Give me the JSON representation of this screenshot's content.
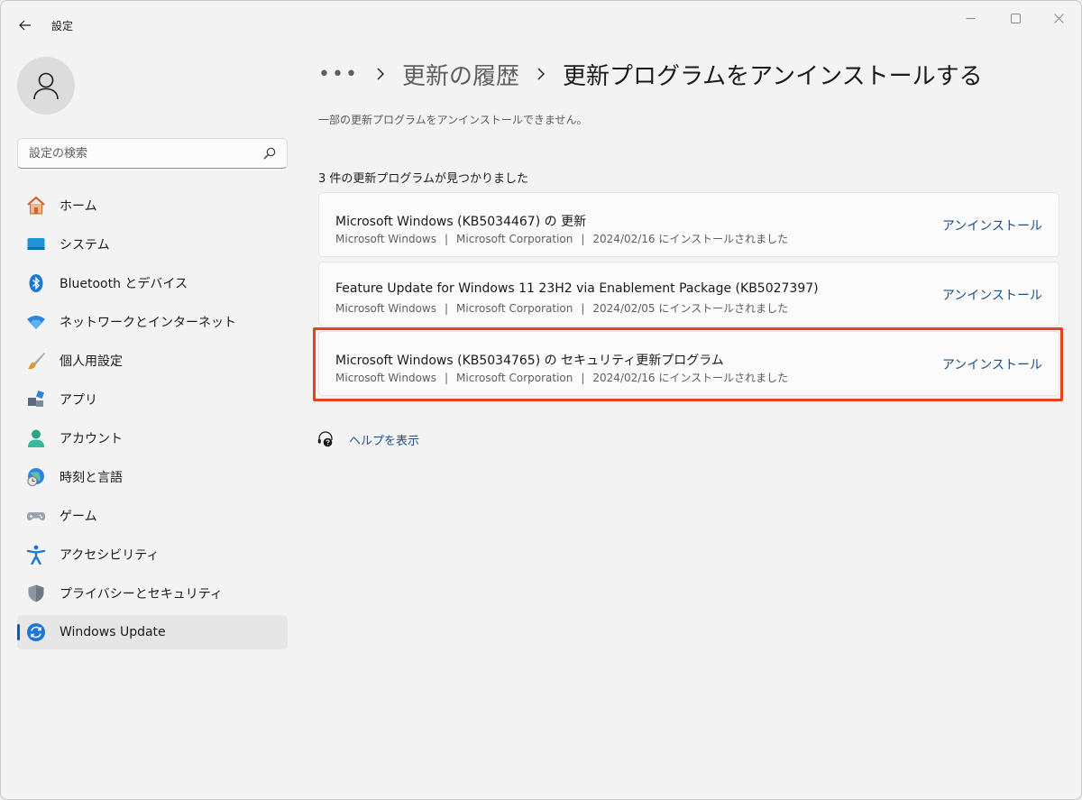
{
  "window": {
    "title": "設定",
    "controls": [
      "minimize-icon",
      "maximize-icon",
      "close-icon"
    ]
  },
  "sidebar": {
    "search_placeholder": "設定の検索",
    "items": [
      {
        "label": "ホーム",
        "icon": "home-icon"
      },
      {
        "label": "システム",
        "icon": "display-icon"
      },
      {
        "label": "Bluetooth とデバイス",
        "icon": "bluetooth-icon"
      },
      {
        "label": "ネットワークとインターネット",
        "icon": "wifi-icon"
      },
      {
        "label": "個人用設定",
        "icon": "brush-icon"
      },
      {
        "label": "アプリ",
        "icon": "apps-icon"
      },
      {
        "label": "アカウント",
        "icon": "account-icon"
      },
      {
        "label": "時刻と言語",
        "icon": "globe-clock-icon"
      },
      {
        "label": "ゲーム",
        "icon": "gamepad-icon"
      },
      {
        "label": "アクセシビリティ",
        "icon": "accessibility-icon"
      },
      {
        "label": "プライバシーとセキュリティ",
        "icon": "shield-icon"
      },
      {
        "label": "Windows Update",
        "icon": "sync-icon",
        "active": true
      }
    ]
  },
  "breadcrumb": {
    "more": "•••",
    "previous": "更新の履歴",
    "current": "更新プログラムをアンインストールする"
  },
  "main": {
    "note": "一部の更新プログラムをアンインストールできません。",
    "count_text": "3 件の更新プログラムが見つかりました",
    "updates": [
      {
        "name": "Microsoft Windows (KB5034467) の 更新",
        "product": "Microsoft Windows",
        "publisher": "Microsoft Corporation",
        "installed": "2024/02/16 にインストールされました",
        "action": "アンインストール"
      },
      {
        "name": "Feature Update for Windows 11 23H2 via Enablement Package (KB5027397)",
        "product": "Microsoft Windows",
        "publisher": "Microsoft Corporation",
        "installed": "2024/02/05 にインストールされました",
        "action": "アンインストール"
      },
      {
        "name": "Microsoft Windows (KB5034765) の セキュリティ更新プログラム",
        "product": "Microsoft Windows",
        "publisher": "Microsoft Corporation",
        "installed": "2024/02/16 にインストールされました",
        "action": "アンインストール",
        "highlighted": true
      }
    ],
    "help_label": "ヘルプを表示"
  },
  "colors": {
    "accent": "#005fb8",
    "link": "#1b4f8c",
    "highlight": "#e8401c"
  },
  "sep": "|"
}
